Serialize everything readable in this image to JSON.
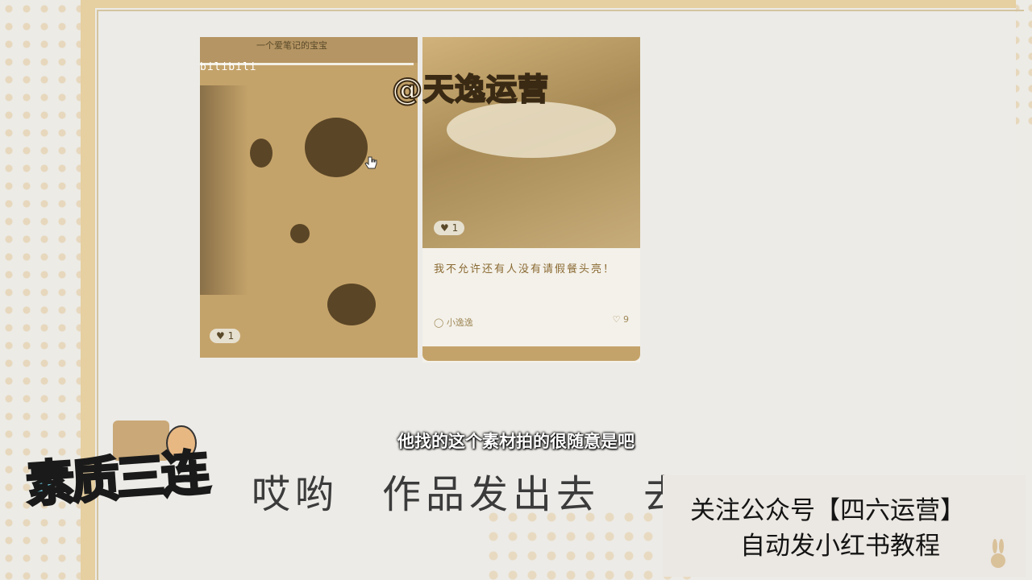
{
  "card_left": {
    "top_text": "一个爱笔记的宝宝",
    "brand": "bilibili",
    "likes": "1"
  },
  "card_right": {
    "watermark": "@天逸运营",
    "likes_img": "1",
    "title": "我不允许还有人没有请假餐头亮！",
    "author": "小逸逸",
    "likes": "9"
  },
  "subtitle": "他找的这个素材拍的很随意是吧",
  "big_text": "哎哟　作品发出去　去了",
  "logo_text": "素质三连",
  "notice": {
    "line1": "关注公众号【四六运营】",
    "line2": "自动发小红书教程"
  },
  "colors": {
    "accent": "#e6cfa0",
    "logo": "#6fd3e8"
  }
}
